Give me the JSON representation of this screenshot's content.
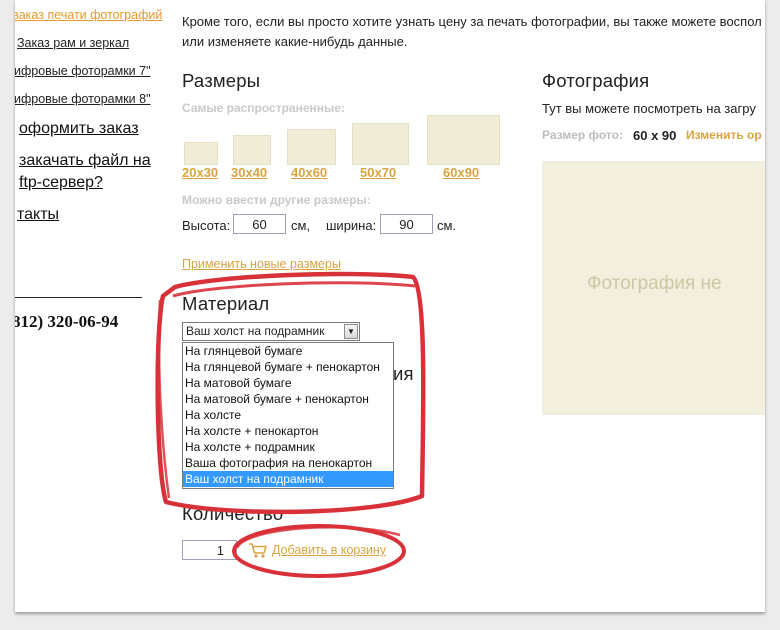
{
  "sidebar": {
    "items": [
      {
        "label": "заказ печати фотографий"
      },
      {
        "label": "Заказ рам и зеркал"
      },
      {
        "label": "ифровые фоторамки 7\""
      },
      {
        "label": "ифровые фоторамки 8\""
      },
      {
        "label": "оформить заказ"
      },
      {
        "label": "закачать файл на"
      },
      {
        "label": "ftp-сервер?"
      },
      {
        "label": "такты"
      }
    ],
    "phone": "812) 320-06-94"
  },
  "intro": {
    "line1": "Кроме того, если вы просто хотите узнать цену за печать фотографии, вы также можете воспол",
    "line2": "или изменяете какие-нибудь данные."
  },
  "sizes": {
    "title": "Размеры",
    "common_label": "Самые распространенные:",
    "options": [
      {
        "label": "20x30"
      },
      {
        "label": "30x40"
      },
      {
        "label": "40x60"
      },
      {
        "label": "50x70"
      },
      {
        "label": "60x90"
      }
    ],
    "custom_label": "Можно ввести другие размеры:",
    "height_label": "Высота:",
    "height_value": "60",
    "unit1": "см,",
    "width_label": "ширина:",
    "width_value": "90",
    "unit2": "см.",
    "apply_link": "Применить новые размеры"
  },
  "material": {
    "title": "Материал",
    "selected": "Ваш холст на подрамник",
    "options": [
      "На глянцевой бумаге",
      "На глянцевой бумаге + пенокартон",
      "На матовой бумаге",
      "На матовой бумаге + пенокартон",
      "На холсте",
      "На холсте + пенокартон",
      "На холсте + подрамник",
      "Ваша фотография на пенокартон",
      "Ваш холст на подрамник"
    ],
    "hidden_heading_fragment": "ия"
  },
  "quantity": {
    "title": "Количество",
    "value": "1",
    "add_to_cart": "Добавить в корзину"
  },
  "photo": {
    "title": "Фотография",
    "description": "Тут вы можете посмотреть на загру",
    "size_label": "Размер фото:",
    "size_value": "60 x 90",
    "change_link": "Изменить ор",
    "placeholder": "Фотография не"
  },
  "colors": {
    "accent": "#d8a441",
    "highlight_ring": "#d9313a",
    "selection": "#3399ff"
  }
}
